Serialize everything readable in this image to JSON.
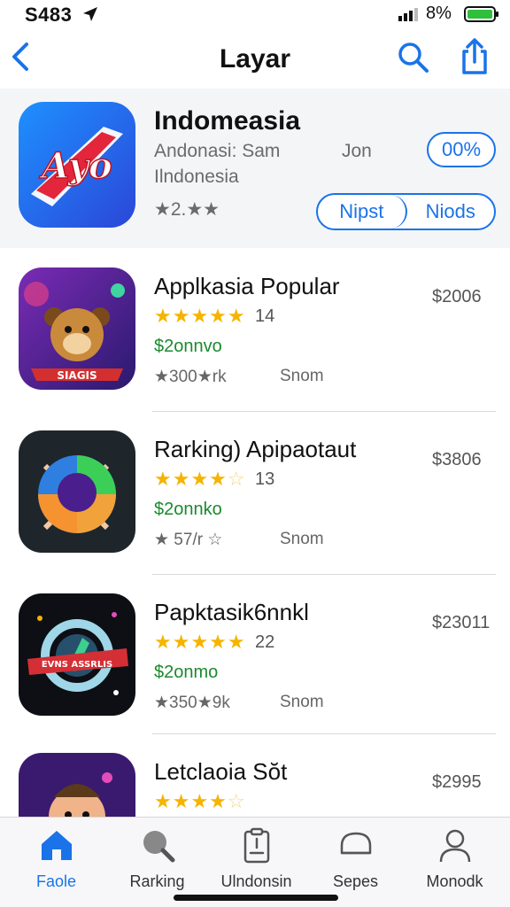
{
  "status": {
    "time": "S483",
    "battery_pct": "8%",
    "battery_color": "#2fbf3c"
  },
  "nav": {
    "title": "Layar"
  },
  "hero": {
    "name": "Indomeasia",
    "subtitle_1": "Andonasi: Sam",
    "subtitle_2": "Ilndonesia",
    "rating": "★2.★★",
    "side_text": "Jon",
    "pct_button": "00%",
    "seg_left": "Nipst",
    "seg_right": "Niods",
    "icon_text": "Ayo"
  },
  "apps": [
    {
      "name": "Applkasia Popular",
      "stars": "★★★★★",
      "stars_empty": "",
      "count": "14",
      "price": "$2006",
      "green": "$2onnvo",
      "meta": "★300★rk",
      "meta2": "Snom",
      "icon_text": "SIAGIS"
    },
    {
      "name": "Rarking) Apipaotaut",
      "stars": "★★★★",
      "stars_empty": "☆",
      "count": "13",
      "price": "$3806",
      "green": "$2onnko",
      "meta": "★ 57/r ☆",
      "meta2": "Snom",
      "icon_text": ""
    },
    {
      "name": "Papktasik6nnkl",
      "stars": "★★★★★",
      "stars_empty": "",
      "count": "22",
      "price": "$23011",
      "green": "$2onmo",
      "meta": "★350★9k",
      "meta2": "Snom",
      "icon_text": "EVNS ASSRLIS"
    },
    {
      "name": "Letclaoia Sŏt",
      "stars": "★★★★",
      "stars_empty": "☆",
      "count": "",
      "price": "$2995",
      "green": "",
      "meta": "",
      "meta2": "",
      "icon_text": ""
    }
  ],
  "tabs": [
    {
      "label": "Faole",
      "icon": "home-icon",
      "active": true
    },
    {
      "label": "Rarking",
      "icon": "search-icon",
      "active": false
    },
    {
      "label": "Ulndonsin",
      "icon": "clipboard-icon",
      "active": false
    },
    {
      "label": "Sepes",
      "icon": "chat-icon",
      "active": false
    },
    {
      "label": "Monodk",
      "icon": "person-icon",
      "active": false
    }
  ],
  "colors": {
    "accent": "#1a73e8",
    "star": "#f5b400",
    "green_text": "#1a8a2e"
  }
}
